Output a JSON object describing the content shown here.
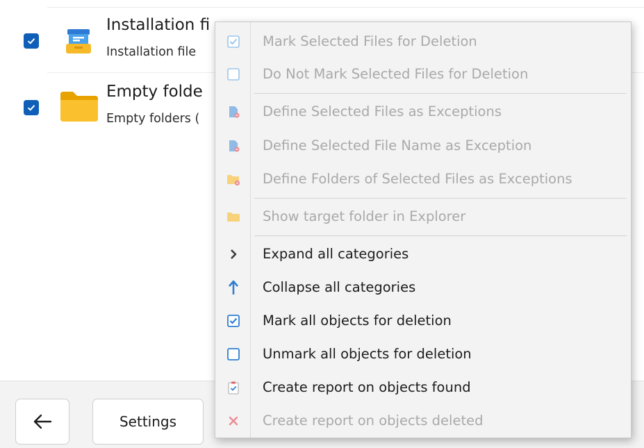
{
  "list": {
    "rows": [
      {
        "title": "Installation fi",
        "subtitle": "Installation file",
        "checked": true,
        "icon": "installer-box-icon"
      },
      {
        "title": "Empty folde",
        "subtitle": "Empty folders (",
        "checked": true,
        "icon": "folder-icon"
      }
    ]
  },
  "bottom_bar": {
    "back_icon": "arrow-left-icon",
    "settings_label": "Settings"
  },
  "context_menu": {
    "items": [
      {
        "label": "Mark Selected Files for Deletion",
        "enabled": false,
        "icon": "checked-box-icon"
      },
      {
        "label": "Do Not Mark Selected Files for Deletion",
        "enabled": false,
        "icon": "unchecked-box-icon"
      },
      {
        "label": "Define Selected Files as Exceptions",
        "enabled": false,
        "icon": "file-exception-icon"
      },
      {
        "label": "Define Selected File Name as Exception",
        "enabled": false,
        "icon": "file-exception-icon"
      },
      {
        "label": "Define Folders of Selected Files as Exceptions",
        "enabled": false,
        "icon": "folder-exception-icon"
      },
      {
        "label": "Show target folder in Explorer",
        "enabled": false,
        "icon": "folder-icon"
      },
      {
        "label": "Expand all categories",
        "enabled": true,
        "icon": "chevron-right-icon"
      },
      {
        "label": "Collapse all categories",
        "enabled": true,
        "icon": "arrow-up-icon"
      },
      {
        "label": "Mark all objects for deletion",
        "enabled": true,
        "icon": "checked-box-icon"
      },
      {
        "label": "Unmark all objects for deletion",
        "enabled": true,
        "icon": "unchecked-box-icon"
      },
      {
        "label": "Create report on objects found",
        "enabled": true,
        "icon": "report-clipboard-icon"
      },
      {
        "label": "Create report on objects deleted",
        "enabled": false,
        "icon": "red-x-icon"
      }
    ]
  },
  "colors": {
    "checkbox_blue": "#0f5fb8",
    "menu_bg": "#f3f3f3",
    "disabled_text": "#a9a9a9",
    "enabled_text": "#1b1b1b",
    "accent_blue": "#2f7fd1",
    "folder_yellow": "#f7b500",
    "delete_red": "#e0606a"
  }
}
